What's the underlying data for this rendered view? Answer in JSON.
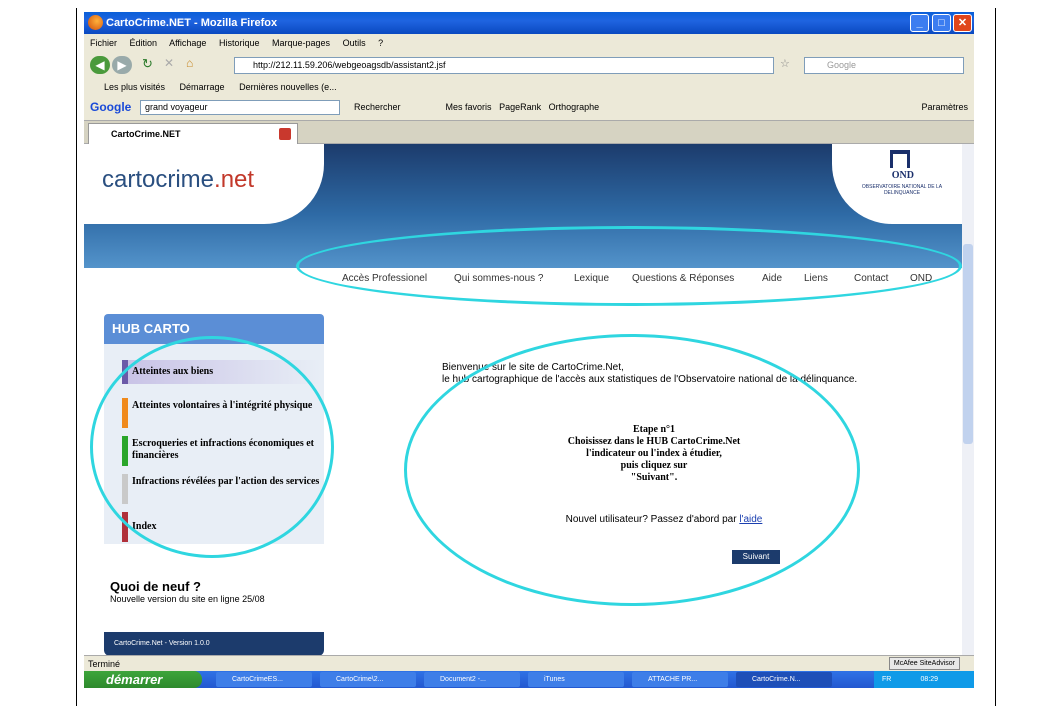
{
  "window": {
    "title": "CartoCrime.NET - Mozilla Firefox"
  },
  "menu": [
    "Fichier",
    "Édition",
    "Affichage",
    "Historique",
    "Marque-pages",
    "Outils",
    "?"
  ],
  "address": {
    "url": "http://212.11.59.206/webgeoagsdb/assistant2.jsf"
  },
  "google_search_placeholder": "Google",
  "bookmarks": [
    "Les plus visités",
    "Démarrage",
    "Dernières nouvelles (e..."
  ],
  "google_toolbar": {
    "logo": "Google",
    "query": "grand voyageur",
    "search_label": "Rechercher",
    "favoris": "Mes favoris",
    "pagerank": "PageRank",
    "orthographe": "Orthographe",
    "params": "Paramètres"
  },
  "tab": {
    "label": "CartoCrime.NET"
  },
  "site": {
    "logo_text": "cartocrime",
    "logo_dot": ".net",
    "ond_short": "OND",
    "ond_full": "OBSERVATOIRE NATIONAL DE LA DELINQUANCE",
    "nav": [
      "Accès Professionel",
      "Qui sommes-nous ?",
      "Lexique",
      "Questions & Réponses",
      "Aide",
      "Liens",
      "Contact",
      "OND"
    ]
  },
  "hub": {
    "title": "HUB CARTO",
    "items": [
      {
        "label": "Atteintes aux biens",
        "color": "#6b5aa8"
      },
      {
        "label": "Atteintes volontaires à l'intégrité physique",
        "color": "#f08a1c"
      },
      {
        "label": "Escroqueries et infractions économiques et financières",
        "color": "#2aa52a"
      },
      {
        "label": "Infractions révélées par l'action des services",
        "color": "#c9c9c9"
      },
      {
        "label": "Index",
        "color": "#b0303a"
      }
    ]
  },
  "news": {
    "title": "Quoi de neuf ?",
    "text": "Nouvelle version du site en ligne 25/08"
  },
  "version": "CartoCrime.Net - Version 1.0.0",
  "welcome": {
    "line1": "Bienvenue sur le site de CartoCrime.Net,",
    "line2": "le hub cartographique de l'accès aux statistiques de l'Observatoire national de la délinquance."
  },
  "etape": {
    "title": "Etape n°1",
    "line1": "Choisissez dans le HUB CartoCrime.Net",
    "line2": "l'indicateur ou l'index à étudier,",
    "line3": "puis cliquez sur",
    "line4": "\"Suivant\"."
  },
  "new_user": {
    "text": "Nouvel utilisateur? Passez d'abord par ",
    "link": "l'aide"
  },
  "next_button": "Suivant",
  "status": "Terminé",
  "mcafee": "McAfee SiteAdvisor",
  "taskbar": {
    "start": "démarrer",
    "tasks": [
      "CartoCrimeES...",
      "CartoCrime\\2...",
      "Document2 -...",
      "iTunes",
      "ATTACHE PR...",
      "CartoCrime.N..."
    ],
    "lang": "FR",
    "time": "08:29"
  },
  "colors": {
    "highlight": "#2fd6e0",
    "header_dark": "#1c3b6c"
  }
}
